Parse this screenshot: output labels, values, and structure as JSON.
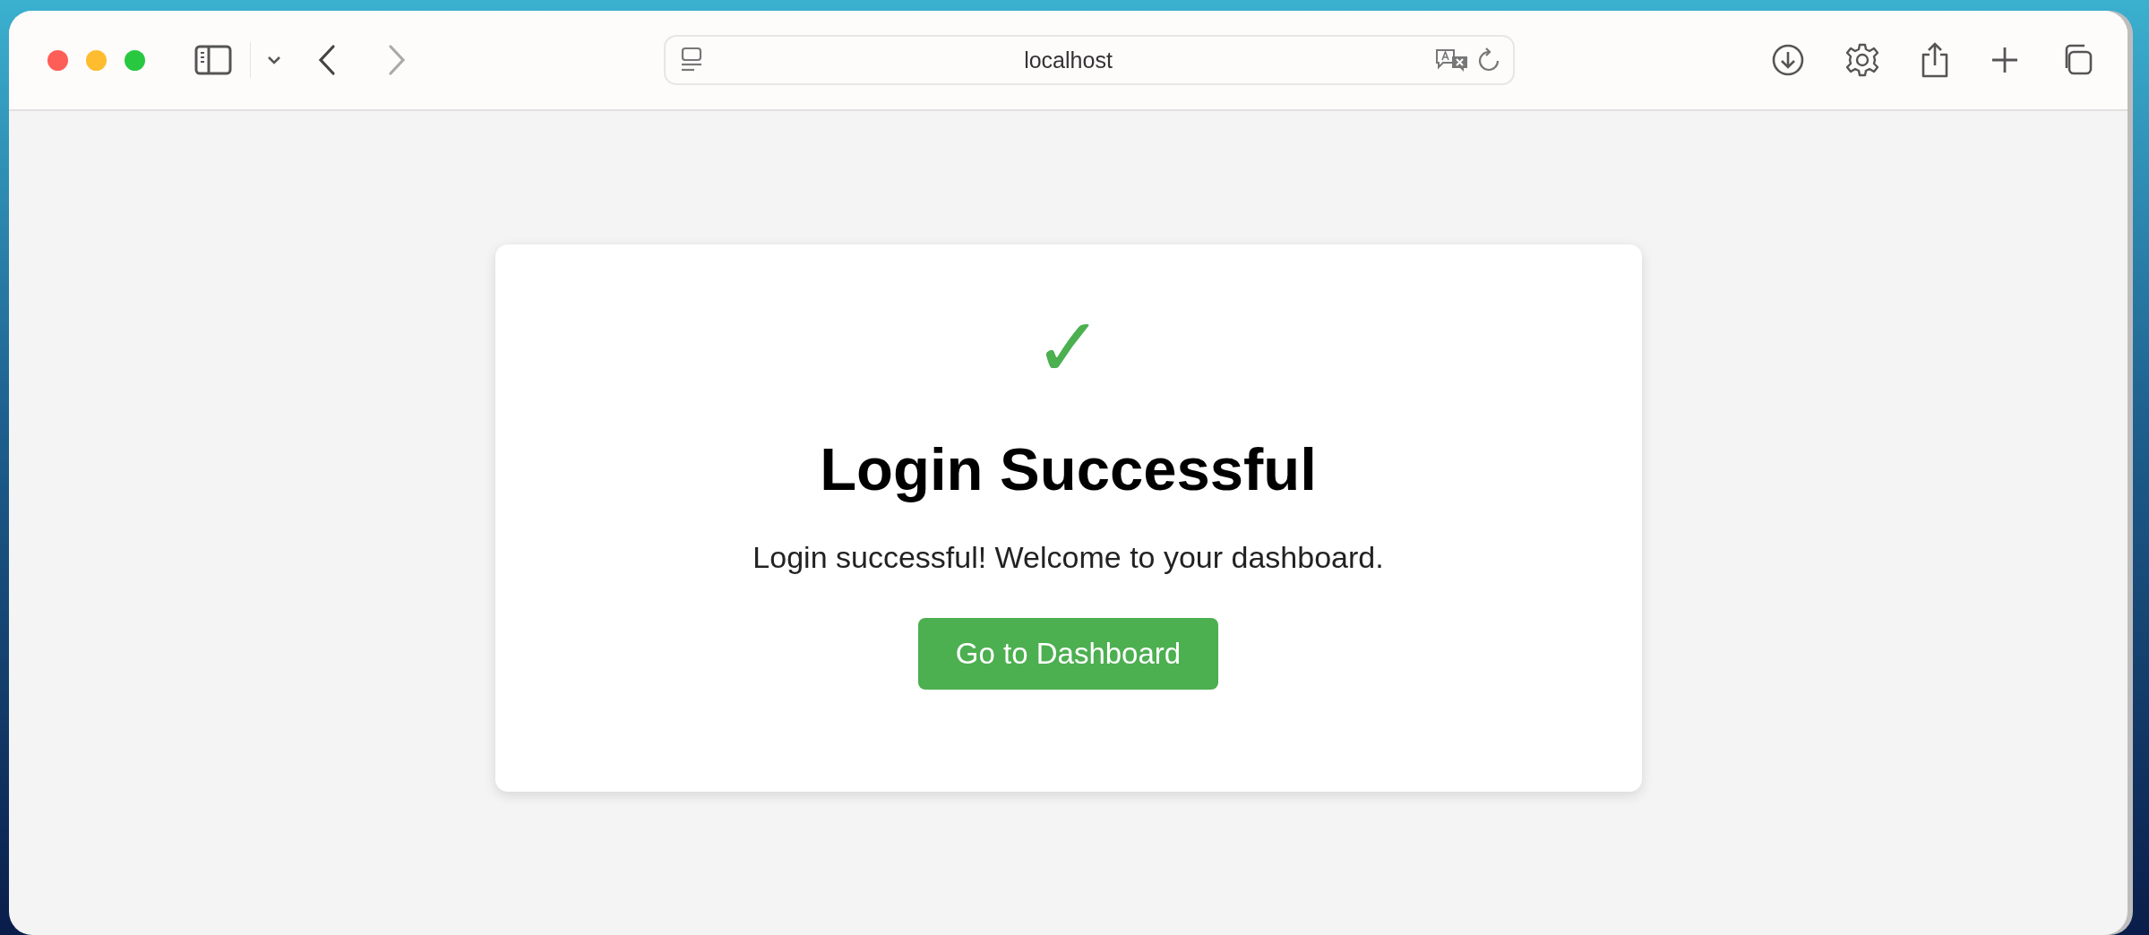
{
  "toolbar": {
    "navigation": [
      {
        "kind": "back",
        "disabled": false
      },
      {
        "kind": "forward",
        "disabled": true
      }
    ],
    "address": "localhost"
  },
  "card": {
    "icon": "✓",
    "title": "Login Successful",
    "message": "Login successful! Welcome to your dashboard.",
    "button": "Go to Dashboard"
  }
}
